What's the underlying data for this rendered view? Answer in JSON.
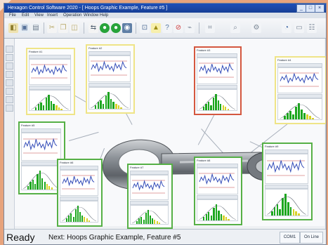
{
  "window": {
    "title": "Hexagon Control Software 2020 - [ Hoops Graphic Example, Feature #5 ]",
    "buttons": [
      "_",
      "□",
      "×"
    ]
  },
  "menu": [
    "File",
    "Edit",
    "View",
    "Insert",
    "Operation",
    "Window",
    "Help"
  ],
  "toolbar": [
    "open-icon",
    "save-icon",
    "print-icon",
    "cut-icon",
    "copy-icon",
    "paste-icon",
    "play-icon",
    "stop-icon",
    "record-icon",
    "step-icon",
    "measure-icon",
    "warning-icon",
    "help-icon",
    "cancel-icon",
    "graph-icon",
    "analysis-icon",
    "zoom-icon",
    "settings-icon",
    "view-icon",
    "window-icon",
    "layout-icon"
  ],
  "status": {
    "ready": "Ready",
    "next": "Next: Hoops Graphic Example, Feature #5",
    "field_1": "COM1",
    "field_2": "On Line"
  },
  "cards": [
    {
      "id": "card-1",
      "title": "Feature #1",
      "color": "yellow"
    },
    {
      "id": "card-2",
      "title": "Feature #2",
      "color": "yellow"
    },
    {
      "id": "card-3",
      "title": "Feature #3",
      "color": "red"
    },
    {
      "id": "card-4",
      "title": "Feature #4",
      "color": "yellow"
    },
    {
      "id": "card-5",
      "title": "Feature #5",
      "color": "green"
    },
    {
      "id": "card-6",
      "title": "Feature #6",
      "color": "green"
    },
    {
      "id": "card-7",
      "title": "Feature #7",
      "color": "green"
    },
    {
      "id": "card-8",
      "title": "Feature #8",
      "color": "green"
    },
    {
      "id": "card-9",
      "title": "Feature #9",
      "color": "green"
    }
  ],
  "charts": {
    "trend_values": [
      5,
      8,
      6,
      9,
      4,
      7,
      5,
      10,
      6,
      8,
      5,
      7,
      4,
      9,
      6,
      8,
      5,
      10,
      7,
      6
    ],
    "hist_values": [
      2,
      4,
      5,
      3,
      8,
      10,
      6,
      4,
      3,
      2,
      1
    ]
  }
}
